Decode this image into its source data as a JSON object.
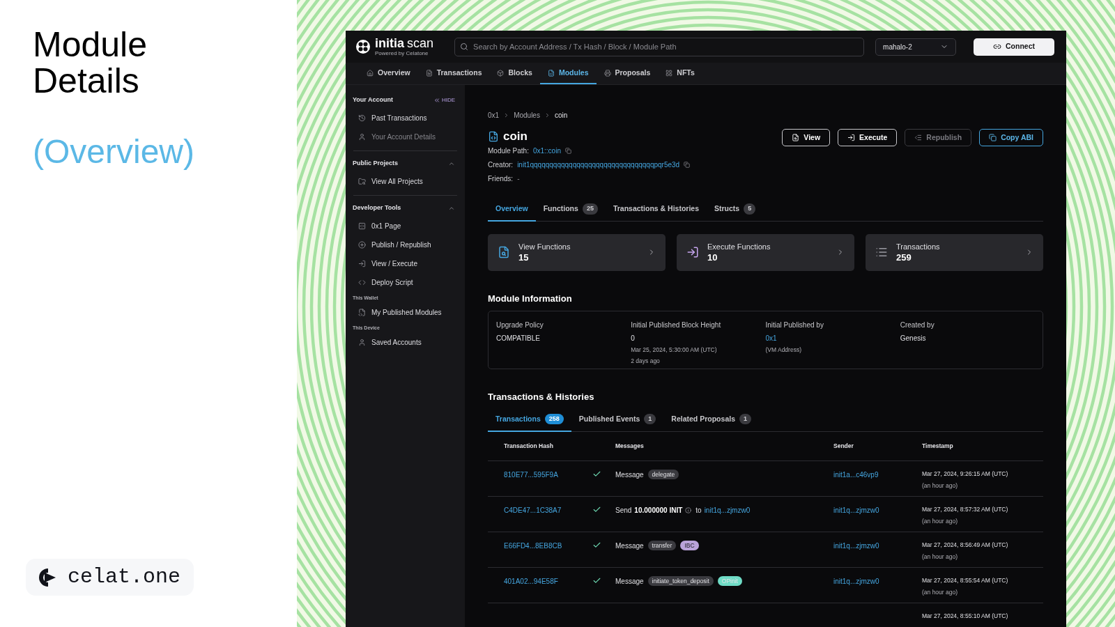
{
  "slide": {
    "title": "Module Details",
    "subtitle": "(Overview)",
    "brand": "celat.one"
  },
  "app": {
    "logo": {
      "name": "initia",
      "product": "scan",
      "tagline": "Powered by Celatone"
    },
    "search": {
      "placeholder": "Search by Account Address / Tx Hash / Block / Module Path"
    },
    "network": "mahalo-2",
    "connect_button": "Connect",
    "nav": [
      {
        "label": "Overview",
        "selected": false
      },
      {
        "label": "Transactions",
        "selected": false
      },
      {
        "label": "Blocks",
        "selected": false
      },
      {
        "label": "Modules",
        "selected": true
      },
      {
        "label": "Proposals",
        "selected": false
      },
      {
        "label": "NFTs",
        "selected": false
      }
    ],
    "sidebar": {
      "hide_label": "HIDE",
      "sections": [
        {
          "kind": "heading",
          "title": "Your Account",
          "items": [
            {
              "label": "Past Transactions",
              "disabled": false
            },
            {
              "label": "Your Account Details",
              "disabled": true
            }
          ]
        },
        {
          "kind": "heading",
          "title": "Public Projects",
          "expanded": true,
          "items": [
            {
              "label": "View All Projects",
              "disabled": false
            }
          ]
        },
        {
          "kind": "heading",
          "title": "Developer Tools",
          "expanded": true,
          "items": [
            {
              "label": "0x1 Page",
              "disabled": false
            },
            {
              "label": "Publish / Republish",
              "disabled": false
            },
            {
              "label": "View / Execute",
              "disabled": false
            },
            {
              "label": "Deploy Script",
              "disabled": false
            }
          ]
        },
        {
          "kind": "caption",
          "title": "This Wallet",
          "items": [
            {
              "label": "My Published Modules",
              "disabled": false
            }
          ]
        },
        {
          "kind": "caption",
          "title": "This Device",
          "items": [
            {
              "label": "Saved Accounts",
              "disabled": false
            }
          ]
        }
      ]
    },
    "breadcrumb": [
      "0x1",
      "Modules",
      "coin"
    ],
    "module": {
      "name": "coin",
      "fields": [
        {
          "label": "Module Path:",
          "value": "0x1::coin",
          "kind": "link",
          "copyable": true
        },
        {
          "label": "Creator:",
          "value": "init1qqqqqqqqqqqqqqqqqqqqqqqqqqqqqqqqpqr5e3d",
          "kind": "link",
          "copyable": true
        },
        {
          "label": "Friends:",
          "value": "-",
          "kind": "plain",
          "copyable": false
        }
      ]
    },
    "actions": [
      {
        "label": "View",
        "kind": "outline",
        "disabled": false
      },
      {
        "label": "Execute",
        "kind": "outline",
        "disabled": false
      },
      {
        "label": "Republish",
        "kind": "outline",
        "disabled": true
      },
      {
        "label": "Copy ABI",
        "kind": "accent",
        "disabled": false
      }
    ],
    "tabs": [
      {
        "label": "Overview",
        "selected": true
      },
      {
        "label": "Functions",
        "count": "25",
        "selected": false
      },
      {
        "label": "Transactions & Histories",
        "selected": false
      },
      {
        "label": "Structs",
        "count": "5",
        "selected": false
      }
    ],
    "stat_cards": [
      {
        "label": "View Functions",
        "value": "15"
      },
      {
        "label": "Execute Functions",
        "value": "10"
      },
      {
        "label": "Transactions",
        "value": "259"
      }
    ],
    "module_info": {
      "title": "Module Information",
      "columns": [
        {
          "label": "Upgrade Policy",
          "lines": [
            {
              "text": "COMPATIBLE",
              "kind": "value"
            }
          ]
        },
        {
          "label": "Initial Published Block Height",
          "lines": [
            {
              "text": "0",
              "kind": "value"
            },
            {
              "text": "Mar 25, 2024, 5:30:00 AM (UTC)",
              "kind": "note"
            },
            {
              "text": "2 days ago",
              "kind": "note"
            }
          ]
        },
        {
          "label": "Initial Published by",
          "lines": [
            {
              "text": "0x1",
              "kind": "link"
            },
            {
              "text": "(VM Address)",
              "kind": "note"
            }
          ]
        },
        {
          "label": "Created by",
          "lines": [
            {
              "text": "Genesis",
              "kind": "value"
            }
          ]
        }
      ]
    },
    "history": {
      "title": "Transactions & Histories",
      "tabs": [
        {
          "label": "Transactions",
          "count": "258",
          "selected": true
        },
        {
          "label": "Published Events",
          "count": "1",
          "selected": false
        },
        {
          "label": "Related Proposals",
          "count": "1",
          "selected": false
        }
      ],
      "columns": [
        "Transaction Hash",
        "Messages",
        "Sender",
        "Timestamp"
      ],
      "rows": [
        {
          "hash": "810E77...595F9A",
          "success": true,
          "message": {
            "kind": "message",
            "label": "Message",
            "tags": [
              {
                "text": "delegate",
                "color": "#3a3a3f"
              }
            ]
          },
          "sender": "init1a...c46vp9",
          "timestamp": "Mar 27, 2024, 9:26:15 AM (UTC)",
          "relative": "(an hour ago)"
        },
        {
          "hash": "C4DE47...1C38A7",
          "success": true,
          "message": {
            "kind": "send",
            "verb": "Send",
            "amount": "10.000000 INIT",
            "to": "to",
            "recipient": "init1q...zjmzw0"
          },
          "sender": "init1q...zjmzw0",
          "timestamp": "Mar 27, 2024, 8:57:32 AM (UTC)",
          "relative": "(an hour ago)"
        },
        {
          "hash": "E66FD4...8EB8CB",
          "success": true,
          "message": {
            "kind": "message",
            "label": "Message",
            "tags": [
              {
                "text": "transfer",
                "color": "#3a3a3f"
              },
              {
                "text": "IBC",
                "color": "#b9a3d9"
              }
            ]
          },
          "sender": "init1q...zjmzw0",
          "timestamp": "Mar 27, 2024, 8:56:49 AM (UTC)",
          "relative": "(an hour ago)"
        },
        {
          "hash": "401A02...94E58F",
          "success": true,
          "message": {
            "kind": "message",
            "label": "Message",
            "tags": [
              {
                "text": "initiate_token_deposit",
                "color": "#3a3a3f"
              },
              {
                "text": "OPinit",
                "color": "#6fdcc6"
              }
            ]
          },
          "sender": "init1q...zjmzw0",
          "timestamp": "Mar 27, 2024, 8:55:54 AM (UTC)",
          "relative": "(an hour ago)"
        },
        {
          "timestamp": "Mar 27, 2024, 8:55:10 AM (UTC)"
        }
      ]
    }
  }
}
